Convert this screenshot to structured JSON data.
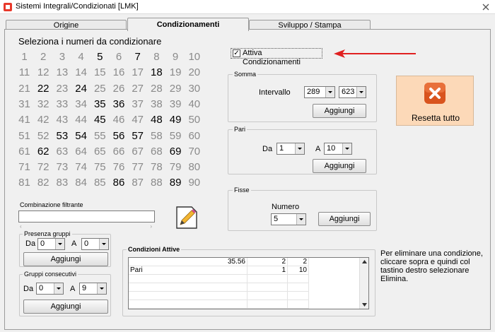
{
  "window": {
    "title": "Sistemi Integrali/Condizionati  [LMK]"
  },
  "tabs": [
    {
      "label": "Origine",
      "active": false
    },
    {
      "label": "Condizionamenti",
      "active": true
    },
    {
      "label": "Sviluppo / Stampa",
      "active": false
    }
  ],
  "selector": {
    "title": "Seleziona i numeri da condizionare",
    "numbers": [
      1,
      2,
      3,
      4,
      5,
      6,
      7,
      8,
      9,
      10,
      11,
      12,
      13,
      14,
      15,
      16,
      17,
      18,
      19,
      20,
      21,
      22,
      23,
      24,
      25,
      26,
      27,
      28,
      29,
      30,
      31,
      32,
      33,
      34,
      35,
      36,
      37,
      38,
      39,
      40,
      41,
      42,
      43,
      44,
      45,
      46,
      47,
      48,
      49,
      50,
      51,
      52,
      53,
      54,
      55,
      56,
      57,
      58,
      59,
      60,
      61,
      62,
      63,
      64,
      65,
      66,
      67,
      68,
      69,
      70,
      71,
      72,
      73,
      74,
      75,
      76,
      77,
      78,
      79,
      80,
      81,
      82,
      83,
      84,
      85,
      86,
      87,
      88,
      89,
      90
    ],
    "selected": [
      5,
      7,
      18,
      22,
      24,
      35,
      36,
      45,
      48,
      49,
      53,
      54,
      56,
      57,
      62,
      69,
      86,
      89
    ]
  },
  "combination_filter": {
    "label": "Combinazione filtrante",
    "value": ""
  },
  "presence_groups": {
    "label": "Presenza gruppi",
    "from_label": "Da",
    "from_value": "0",
    "to_label": "A",
    "to_value": "0",
    "button": "Aggiungi"
  },
  "consecutive_groups": {
    "label": "Gruppi consecutivi",
    "from_label": "Da",
    "from_value": "0",
    "to_label": "A",
    "to_value": "9",
    "button": "Aggiungi"
  },
  "activate": {
    "label": "Attiva Condizionamenti",
    "checked": true,
    "check_mark": "✓"
  },
  "sum": {
    "label": "Somma",
    "range_label": "Intervallo",
    "from_value": "289",
    "to_value": "623",
    "button": "Aggiungi"
  },
  "even": {
    "label": "Pari",
    "from_label": "Da",
    "from_value": "1",
    "to_label": "A",
    "to_value": "10",
    "button": "Aggiungi"
  },
  "fixed": {
    "label": "Fisse",
    "number_label": "Numero",
    "number_value": "5",
    "button": "Aggiungi"
  },
  "reset": {
    "label": "Resetta tutto",
    "icon": "error-x-icon",
    "color": "#fcd9b8"
  },
  "active_conditions": {
    "label": "Condizioni Attive",
    "rows": [
      {
        "name": "",
        "value": "35.56",
        "from": "2",
        "to": "2"
      },
      {
        "name": "Pari",
        "value": "",
        "from": "1",
        "to": "10"
      },
      {
        "name": "",
        "value": "",
        "from": "",
        "to": ""
      },
      {
        "name": "",
        "value": "",
        "from": "",
        "to": ""
      },
      {
        "name": "",
        "value": "",
        "from": "",
        "to": ""
      }
    ]
  },
  "hint": "Per eliminare una condizione, cliccare sopra e quindi col tastino destro selezionare Elimina.",
  "colors": {
    "selected_number": "#000000",
    "unselected_number": "#8a8a8a",
    "arrow": "#e02020",
    "reset_icon": "#d9541e"
  }
}
